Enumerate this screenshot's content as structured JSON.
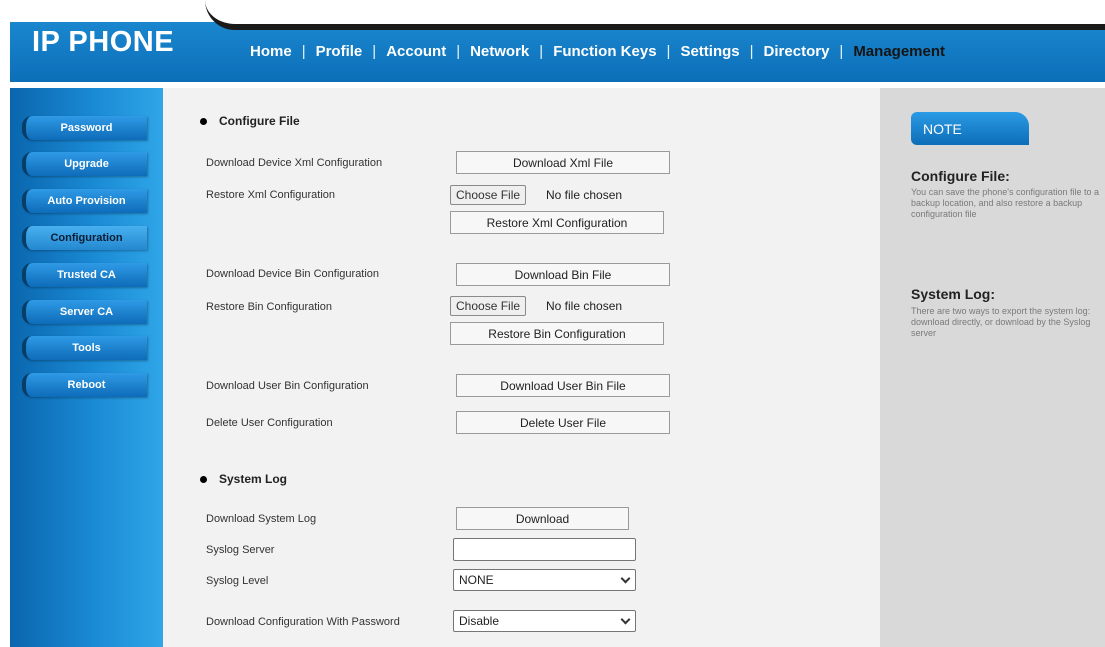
{
  "header": {
    "brand": "IP PHONE",
    "nav": [
      "Home",
      "Profile",
      "Account",
      "Network",
      "Function Keys",
      "Settings",
      "Directory",
      "Management"
    ],
    "active": "Management"
  },
  "sidebar": {
    "items": [
      "Password",
      "Upgrade",
      "Auto Provision",
      "Configuration",
      "Trusted CA",
      "Server CA",
      "Tools",
      "Reboot"
    ],
    "active": "Configuration"
  },
  "configure_file": {
    "title": "Configure File",
    "download_xml_label": "Download Device Xml Configuration",
    "download_xml_button": "Download Xml File",
    "restore_xml_label": "Restore Xml Configuration",
    "choose_file": "Choose File",
    "no_file": "No file chosen",
    "restore_xml_button": "Restore Xml Configuration",
    "download_bin_label": "Download Device Bin Configuration",
    "download_bin_button": "Download Bin File",
    "restore_bin_label": "Restore Bin Configuration",
    "restore_bin_button": "Restore Bin Configuration",
    "download_user_bin_label": "Download User Bin Configuration",
    "download_user_bin_button": "Download User Bin File",
    "delete_user_label": "Delete User Configuration",
    "delete_user_button": "Delete User File"
  },
  "system_log": {
    "title": "System Log",
    "download_label": "Download System Log",
    "download_button": "Download",
    "server_label": "Syslog Server",
    "server_value": "",
    "level_label": "Syslog Level",
    "level_value": "NONE",
    "password_label": "Download Configuration With Password",
    "password_value": "Disable"
  },
  "note": {
    "tab": "NOTE",
    "h1": "Configure File:",
    "p1": "You can save the phone's configuration file to a backup location, and also restore a backup configuration file",
    "h2": "System Log:",
    "p2": "There are two ways to export the system log: download directly, or download by the Syslog server"
  },
  "colors": {
    "header_blue": "#0c6fb8",
    "sidebar_blue": "#1a8ad4",
    "panel_gray": "#f2f2f2",
    "note_gray": "#d9d9d9"
  }
}
